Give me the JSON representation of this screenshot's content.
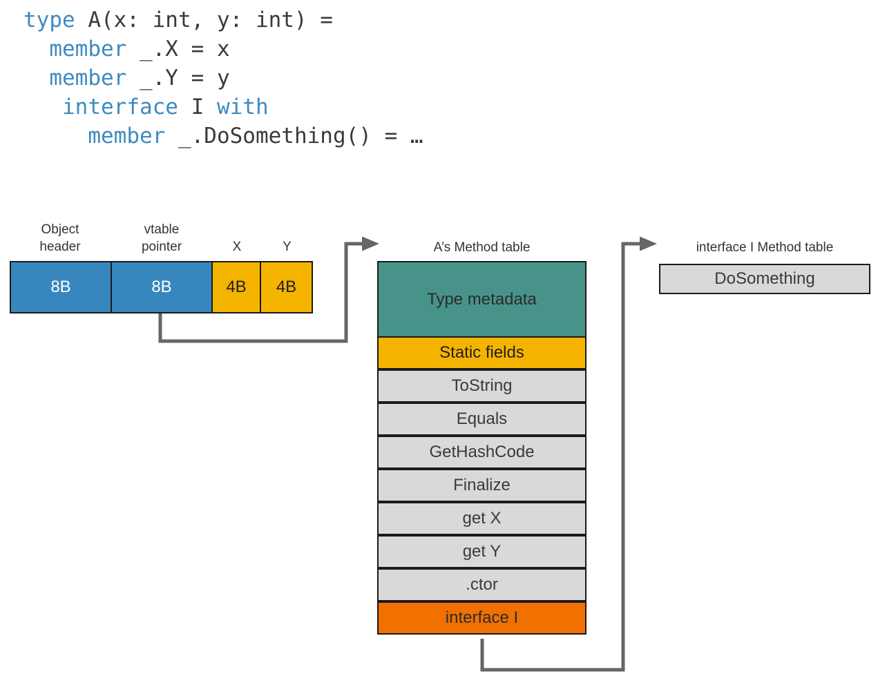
{
  "code": {
    "language": "fsharp",
    "lines": [
      [
        {
          "t": "type",
          "k": true
        },
        {
          "t": " A(x: int, y: int) =",
          "k": false
        }
      ],
      [
        {
          "t": "  ",
          "k": false
        },
        {
          "t": "member",
          "k": true
        },
        {
          "t": " _.X = x",
          "k": false
        }
      ],
      [
        {
          "t": "  ",
          "k": false
        },
        {
          "t": "member",
          "k": true
        },
        {
          "t": " _.Y = y",
          "k": false
        }
      ],
      [
        {
          "t": "   ",
          "k": false
        },
        {
          "t": "interface",
          "k": true
        },
        {
          "t": " I ",
          "k": false
        },
        {
          "t": "with",
          "k": true
        }
      ],
      [
        {
          "t": "     ",
          "k": false
        },
        {
          "t": "member",
          "k": true
        },
        {
          "t": " _.DoSomething() = …",
          "k": false
        }
      ]
    ]
  },
  "object_layout": {
    "labels": [
      "Object\nheader",
      "vtable\npointer",
      "X",
      "Y"
    ],
    "cells": [
      {
        "text": "8B",
        "color": "blue"
      },
      {
        "text": "8B",
        "color": "blue"
      },
      {
        "text": "4B",
        "color": "amber"
      },
      {
        "text": "4B",
        "color": "amber"
      }
    ]
  },
  "method_table": {
    "title": "A’s Method table",
    "rows": [
      {
        "text": "Type metadata",
        "color": "teal"
      },
      {
        "text": "Static fields",
        "color": "amber"
      },
      {
        "text": "ToString",
        "color": "grey"
      },
      {
        "text": "Equals",
        "color": "grey"
      },
      {
        "text": "GetHashCode",
        "color": "grey"
      },
      {
        "text": "Finalize",
        "color": "grey"
      },
      {
        "text": "get X",
        "color": "grey"
      },
      {
        "text": "get Y",
        "color": "grey"
      },
      {
        "text": ".ctor",
        "color": "grey"
      },
      {
        "text": "interface I",
        "color": "orange"
      }
    ]
  },
  "interface_table": {
    "title": "interface I Method table",
    "rows": [
      {
        "text": "DoSomething",
        "color": "grey"
      }
    ]
  },
  "colors": {
    "keyword": "#3d8bc0",
    "code_text": "#3a3a3a",
    "blue": "#3787be",
    "amber": "#f5b400",
    "teal": "#479389",
    "grey": "#d9d9d9",
    "orange": "#f07000",
    "connector": "#666666",
    "border": "#1a1a1a",
    "background": "#ffffff"
  }
}
